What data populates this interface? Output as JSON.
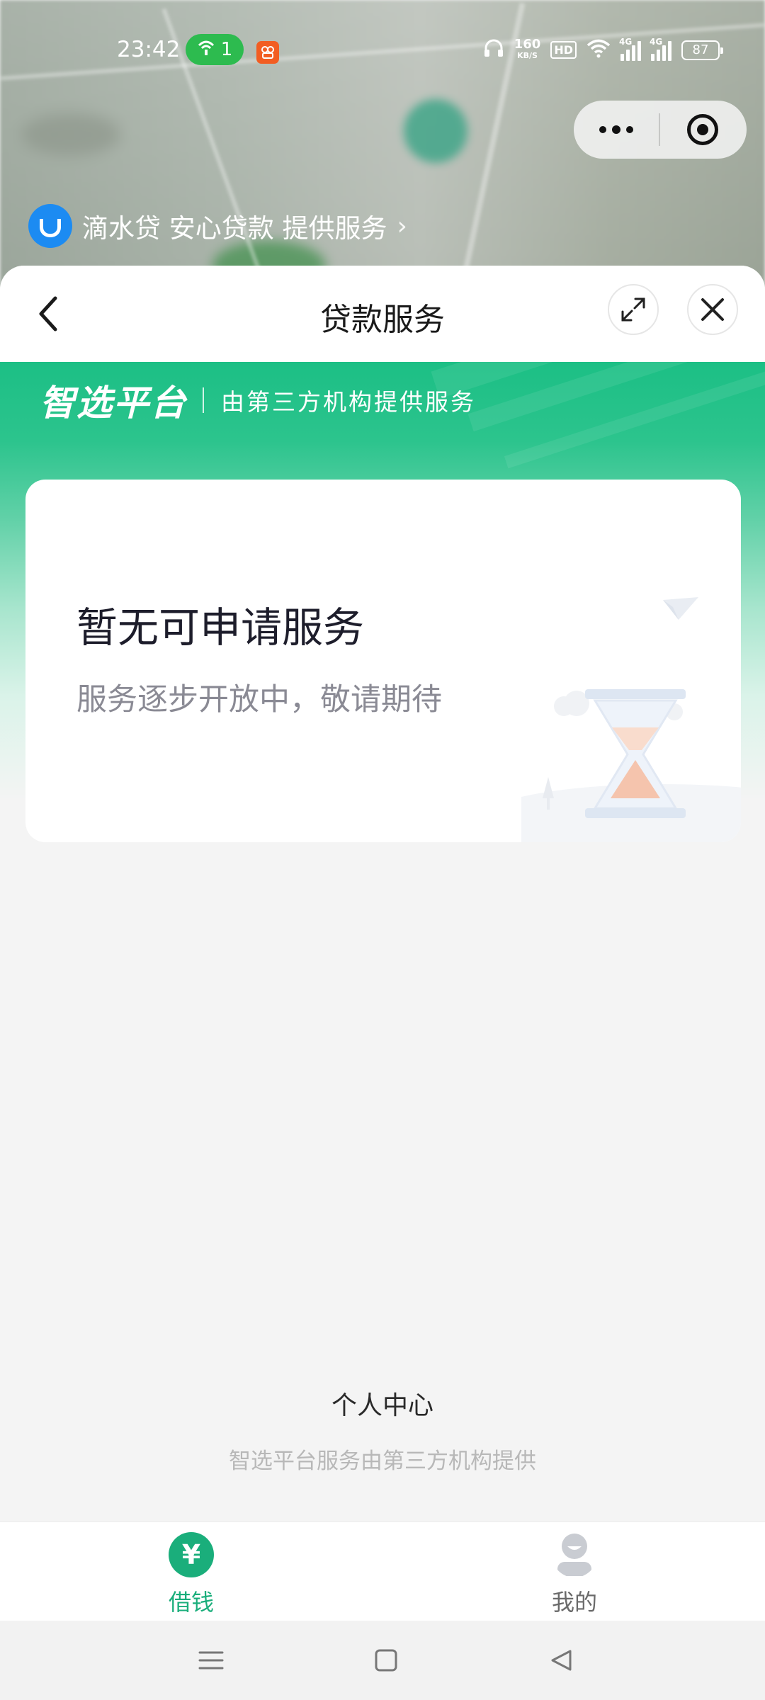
{
  "status_bar": {
    "time": "23:42",
    "hotspot_count": "1",
    "net_speed_value": "160",
    "net_speed_unit": "KB/S",
    "hd_label": "HD",
    "sim_tag_1": "4G",
    "sim_tag_2": "4G",
    "battery": "87"
  },
  "provider": {
    "text": "滴水贷 安心贷款 提供服务",
    "chevron": "›"
  },
  "header": {
    "title": "贷款服务"
  },
  "banner": {
    "brand": "智选平台",
    "subtitle": "由第三方机构提供服务"
  },
  "empty_state": {
    "title": "暂无可申请服务",
    "subtitle": "服务逐步开放中，敬请期待"
  },
  "footer": {
    "personal_center": "个人中心",
    "note": "智选平台服务由第三方机构提供"
  },
  "tabs": [
    {
      "label": "借钱",
      "icon": "yen-icon",
      "active": true
    },
    {
      "label": "我的",
      "icon": "user-icon",
      "active": false
    }
  ],
  "colors": {
    "accent": "#1aae7b",
    "banner_top": "#1cbf85",
    "provider_logo": "#1c8bf2"
  }
}
